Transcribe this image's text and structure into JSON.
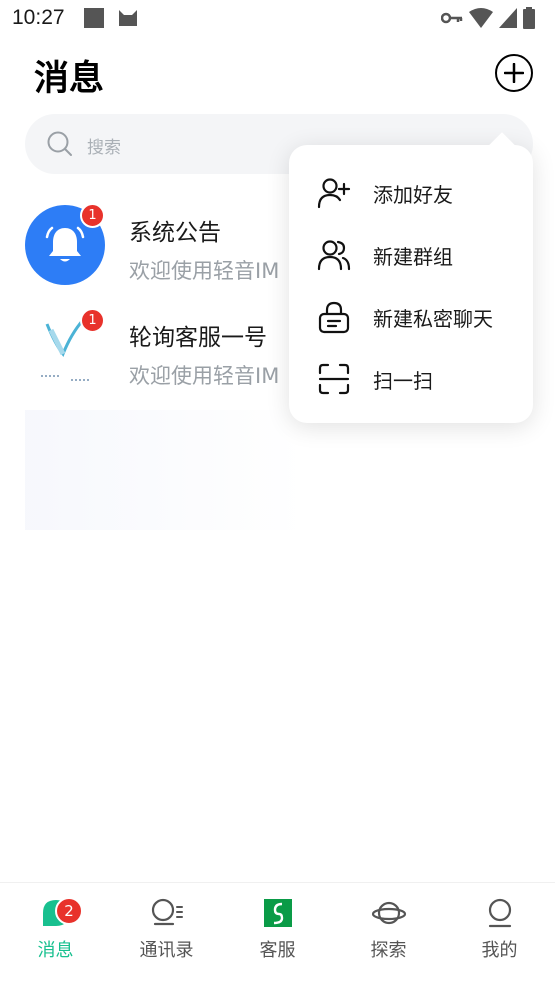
{
  "status_bar": {
    "time": "10:27"
  },
  "header": {
    "title": "消息"
  },
  "search": {
    "placeholder": "搜索"
  },
  "conversations": [
    {
      "title": "系统公告",
      "preview": "欢迎使用轻音IM",
      "unread": "1",
      "avatar": "bell-icon"
    },
    {
      "title": "轮询客服一号",
      "preview": "欢迎使用轻音IM",
      "unread": "1",
      "avatar": "brand-logo"
    }
  ],
  "popup_menu": {
    "items": [
      {
        "label": "添加好友",
        "icon": "add-user-icon"
      },
      {
        "label": "新建群组",
        "icon": "group-icon"
      },
      {
        "label": "新建私密聊天",
        "icon": "lock-icon"
      },
      {
        "label": "扫一扫",
        "icon": "scan-icon"
      }
    ]
  },
  "bottom_nav": {
    "items": [
      {
        "label": "消息",
        "icon": "chat-icon",
        "badge": "2",
        "active": true
      },
      {
        "label": "通讯录",
        "icon": "contacts-icon"
      },
      {
        "label": "客服",
        "icon": "service-icon"
      },
      {
        "label": "探索",
        "icon": "planet-icon"
      },
      {
        "label": "我的",
        "icon": "profile-icon"
      }
    ]
  },
  "colors": {
    "accent": "#18c08f",
    "badge": "#e8322b",
    "avatar_blue": "#2d7df6"
  }
}
